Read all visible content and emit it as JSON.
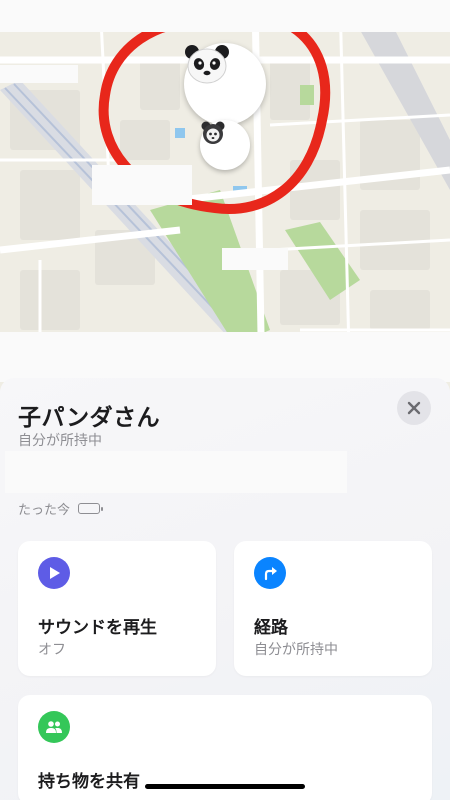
{
  "item": {
    "name": "子パンダさん",
    "status": "自分が所持中",
    "updated": "たった今"
  },
  "actions": [
    {
      "label": "サウンドを再生",
      "sub": "オフ",
      "icon": "play-icon",
      "color": "#5e5ce6"
    },
    {
      "label": "経路",
      "sub": "自分が所持中",
      "icon": "directions-icon",
      "color": "#0a84ff"
    },
    {
      "label": "持ち物を共有",
      "icon": "people-icon",
      "color": "#34c759"
    }
  ],
  "map": {
    "pins": [
      "panda-emoji-icon",
      "panda-item-icon"
    ],
    "annotation_color": "#e8271b"
  }
}
